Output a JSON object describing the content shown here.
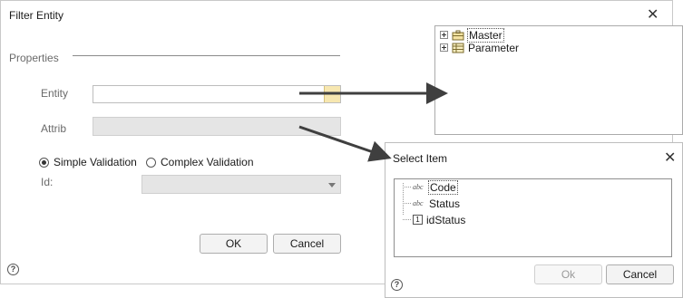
{
  "main_dialog": {
    "title": "Filter Entity",
    "close_glyph": "✕",
    "group_label": "Properties",
    "entity_label": "Entity",
    "entity_value": "",
    "attrib_label": "Attrib",
    "attrib_value": "",
    "simple_validation_label": "Simple Validation",
    "complex_validation_label": "Complex Validation",
    "selected_validation": "Simple Validation",
    "id_label": "Id:",
    "id_value": "",
    "ok_label": "OK",
    "cancel_label": "Cancel",
    "help_glyph": "?"
  },
  "tree_panel": {
    "items": [
      {
        "label": "Master",
        "icon": "briefcase-icon"
      },
      {
        "label": "Parameter",
        "icon": "table-icon"
      }
    ]
  },
  "select_dialog": {
    "title": "Select Item",
    "close_glyph": "✕",
    "items": [
      {
        "label": "Code",
        "type_badge": "abc"
      },
      {
        "label": "Status",
        "type_badge": "abc"
      },
      {
        "label": "idStatus",
        "type_badge": "1"
      }
    ],
    "ok_label": "Ok",
    "cancel_label": "Cancel",
    "help_glyph": "?"
  },
  "colors": {
    "arrow": "#3f3f3f",
    "disabled_field": "#e5e5e5",
    "ellipsis_button": "#f7e7b0"
  }
}
